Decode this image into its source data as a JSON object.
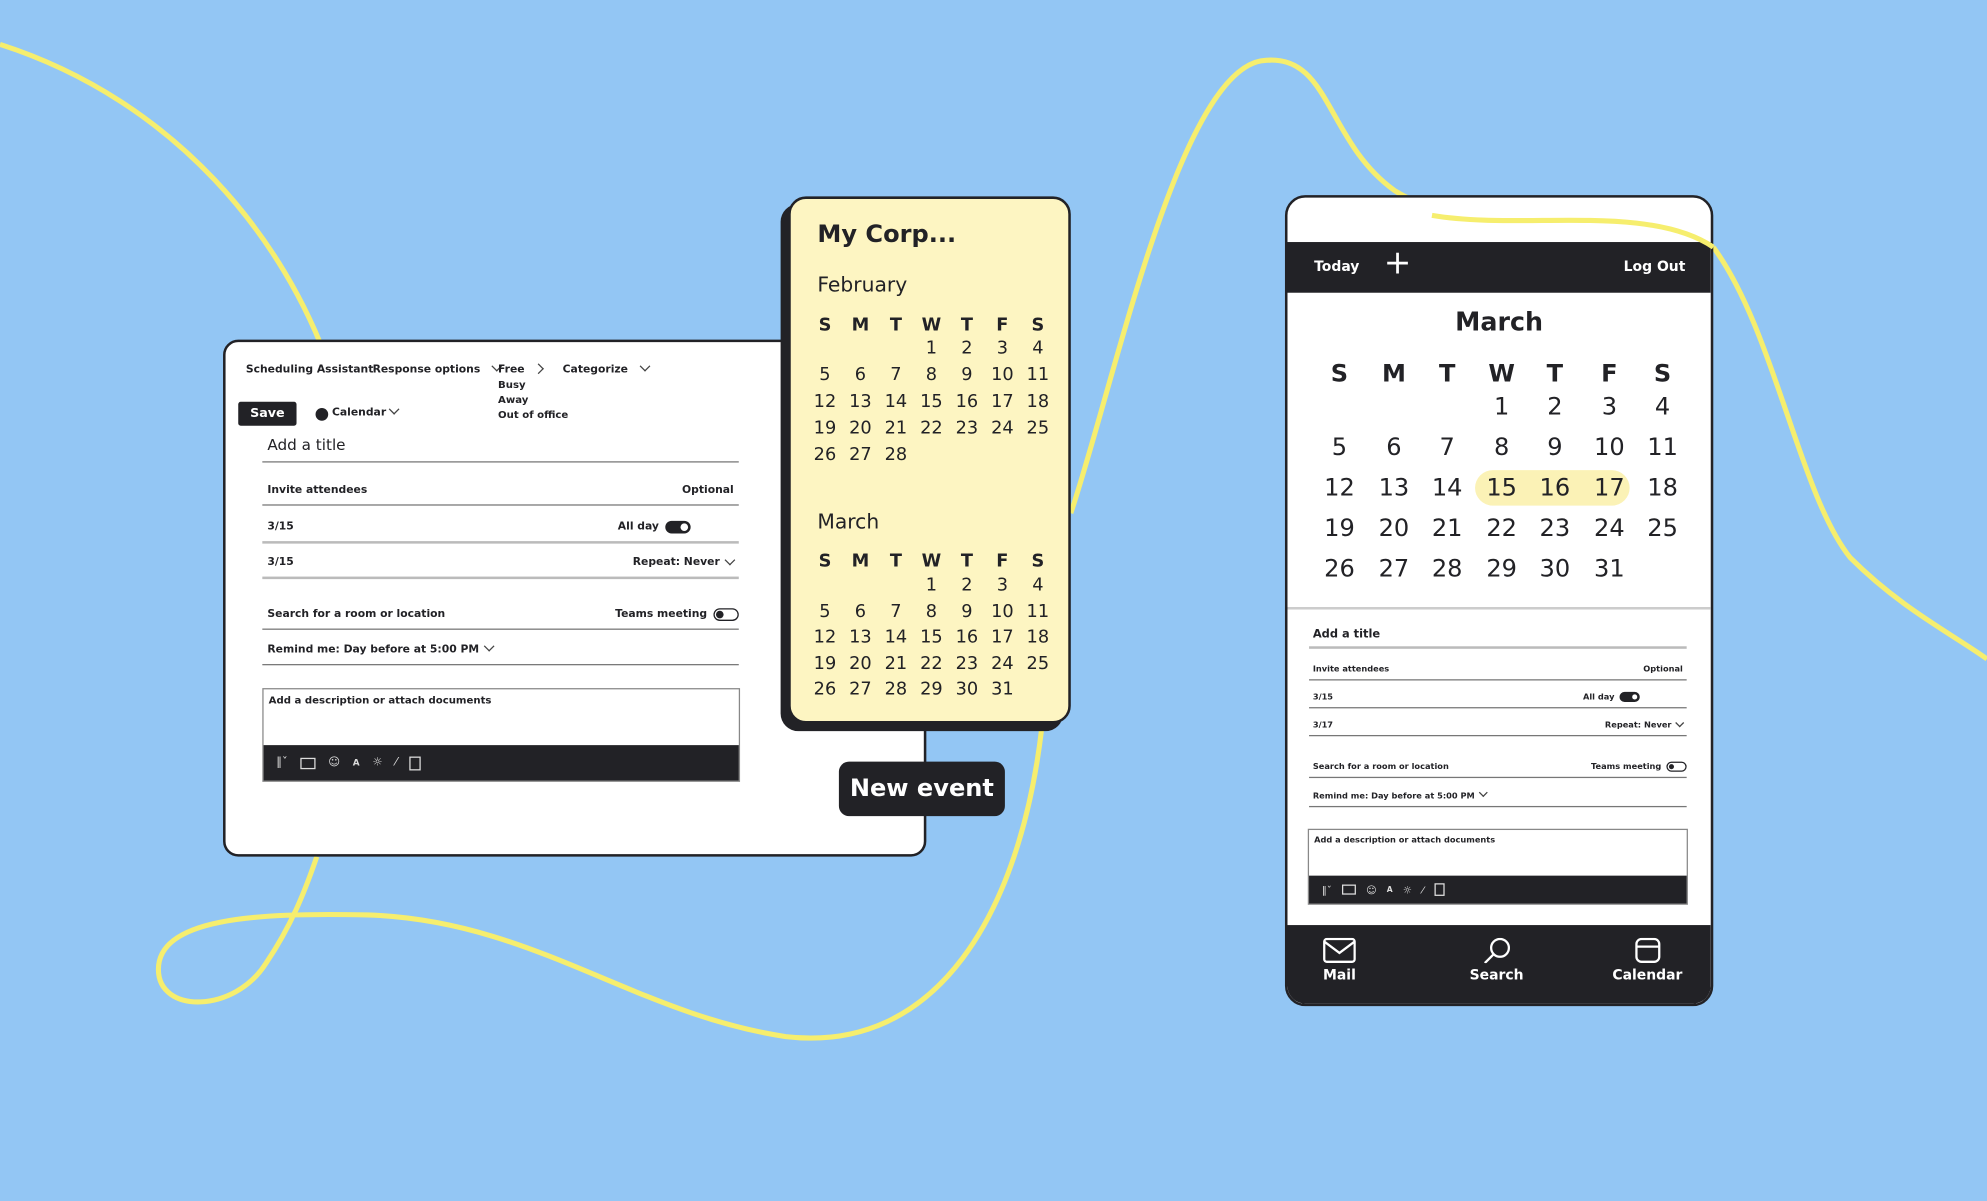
{
  "colors": {
    "background": "#93c6f4",
    "accent_yellow": "#f6ee6e",
    "card_yellow": "#fdf5c2",
    "dark": "#222226",
    "highlight": "#fbf2b6"
  },
  "desktop_form": {
    "toolbar": {
      "scheduling": "Scheduling Assistant",
      "response": "Response options",
      "status_options": [
        "Free",
        "Busy",
        "Away",
        "Out of office"
      ],
      "categorize": "Categorize"
    },
    "save_label": "Save",
    "calendar_label": "Calendar",
    "title_placeholder": "Add a title",
    "attendees_placeholder": "Invite attendees",
    "attendees_hint": "Optional",
    "start_date": "3/15",
    "all_day_label": "All day",
    "all_day_on": true,
    "end_date": "3/15",
    "repeat_label": "Repeat: Never",
    "location_placeholder": "Search for a room or location",
    "teams_label": "Teams meeting",
    "teams_on": false,
    "remind_label": "Remind me: Day before at 5:00 PM",
    "description_placeholder": "Add a description or attach documents",
    "format_icons": [
      "paperclip-icon",
      "image-icon",
      "emoji-icon",
      "font-color-icon",
      "brightness-icon",
      "draw-icon",
      "document-icon"
    ]
  },
  "mini_calendar": {
    "title": "My Corp...",
    "weekdays": [
      "S",
      "M",
      "T",
      "W",
      "T",
      "F",
      "S"
    ],
    "months": [
      {
        "name": "February",
        "weeks": [
          [
            "",
            "",
            "",
            "1",
            "2",
            "3",
            "4"
          ],
          [
            "5",
            "6",
            "7",
            "8",
            "9",
            "10",
            "11"
          ],
          [
            "12",
            "13",
            "14",
            "15",
            "16",
            "17",
            "18"
          ],
          [
            "19",
            "20",
            "21",
            "22",
            "23",
            "24",
            "25"
          ],
          [
            "26",
            "27",
            "28",
            "",
            "",
            "",
            ""
          ]
        ]
      },
      {
        "name": "March",
        "weeks": [
          [
            "",
            "",
            "",
            "1",
            "2",
            "3",
            "4"
          ],
          [
            "5",
            "6",
            "7",
            "8",
            "9",
            "10",
            "11"
          ],
          [
            "12",
            "13",
            "14",
            "15",
            "16",
            "17",
            "18"
          ],
          [
            "19",
            "20",
            "21",
            "22",
            "23",
            "24",
            "25"
          ],
          [
            "26",
            "27",
            "28",
            "29",
            "30",
            "31",
            ""
          ]
        ]
      }
    ]
  },
  "new_event_label": "New event",
  "phone": {
    "today_label": "Today",
    "add_icon": "plus-icon",
    "logout_label": "Log Out",
    "month": "March",
    "weekdays": [
      "S",
      "M",
      "T",
      "W",
      "T",
      "F",
      "S"
    ],
    "weeks": [
      [
        "",
        "",
        "",
        "1",
        "2",
        "3",
        "4"
      ],
      [
        "5",
        "6",
        "7",
        "8",
        "9",
        "10",
        "11"
      ],
      [
        "12",
        "13",
        "14",
        "15",
        "16",
        "17",
        "18"
      ],
      [
        "19",
        "20",
        "21",
        "22",
        "23",
        "24",
        "25"
      ],
      [
        "26",
        "27",
        "28",
        "29",
        "30",
        "31",
        ""
      ]
    ],
    "selected_range": [
      "15",
      "17"
    ],
    "form": {
      "title_placeholder": "Add a title",
      "attendees_placeholder": "Invite attendees",
      "attendees_hint": "Optional",
      "start_date": "3/15",
      "all_day_label": "All day",
      "all_day_on": true,
      "end_date": "3/17",
      "repeat_label": "Repeat: Never",
      "location_placeholder": "Search for a room or location",
      "teams_label": "Teams meeting",
      "teams_on": false,
      "remind_label": "Remind me: Day before at 5:00 PM",
      "description_placeholder": "Add a description or attach documents"
    },
    "nav": [
      {
        "label": "Mail",
        "icon": "mail-icon"
      },
      {
        "label": "Search",
        "icon": "search-icon"
      },
      {
        "label": "Calendar",
        "icon": "calendar-icon"
      }
    ]
  }
}
